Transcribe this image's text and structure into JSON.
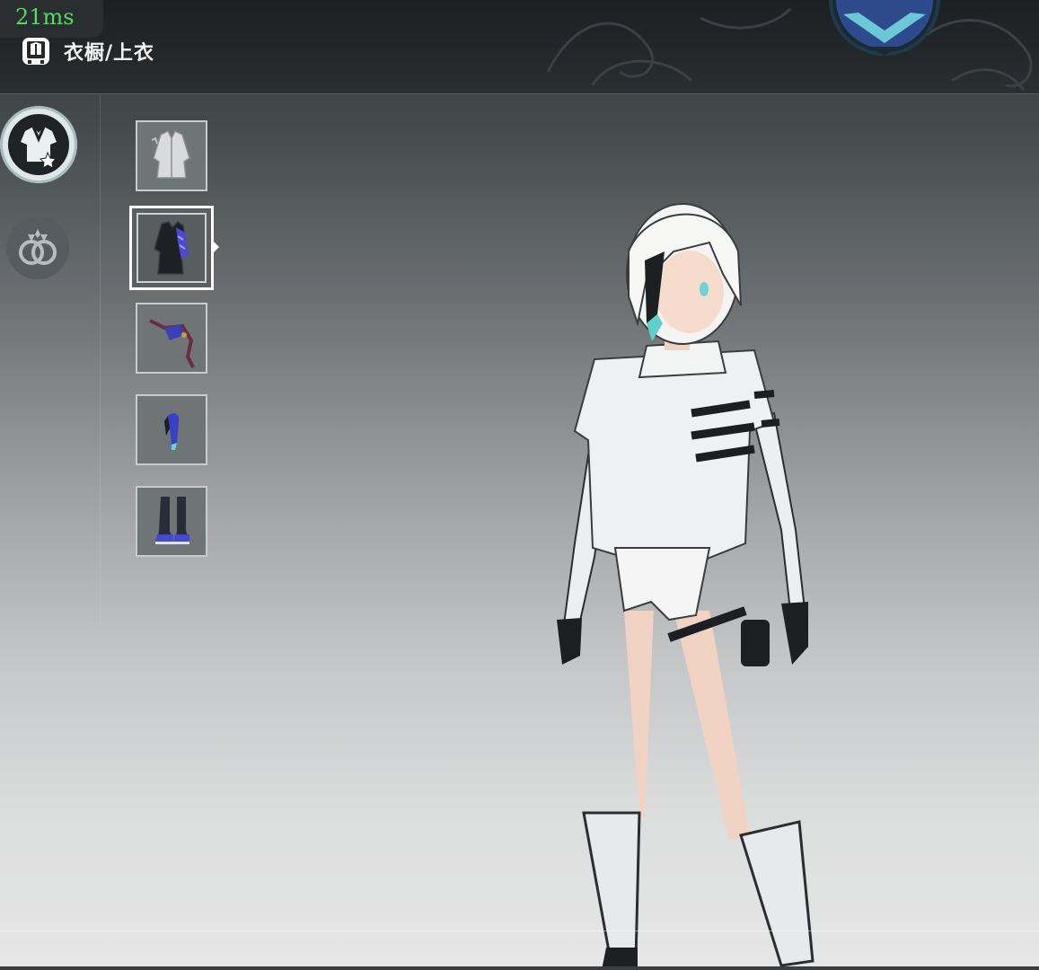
{
  "hud": {
    "latency": "21ms"
  },
  "header": {
    "breadcrumb": "衣橱/上衣",
    "breadcrumb_icon": "wardrobe-icon"
  },
  "categories": [
    {
      "icon": "shirt-icon",
      "selected": true
    },
    {
      "icon": "rings-icon",
      "selected": false
    }
  ],
  "outfit_slots": [
    {
      "icon": "white-coat-icon",
      "selected": false
    },
    {
      "icon": "black-jacket-icon",
      "selected": true
    },
    {
      "icon": "sash-accessory-icon",
      "selected": false
    },
    {
      "icon": "blue-hairpiece-icon",
      "selected": false
    },
    {
      "icon": "boots-icon",
      "selected": false
    }
  ],
  "colors": {
    "accent_text": "#4ee05a",
    "slot_border": "#c9cccd",
    "selected_border": "#ffffff"
  }
}
